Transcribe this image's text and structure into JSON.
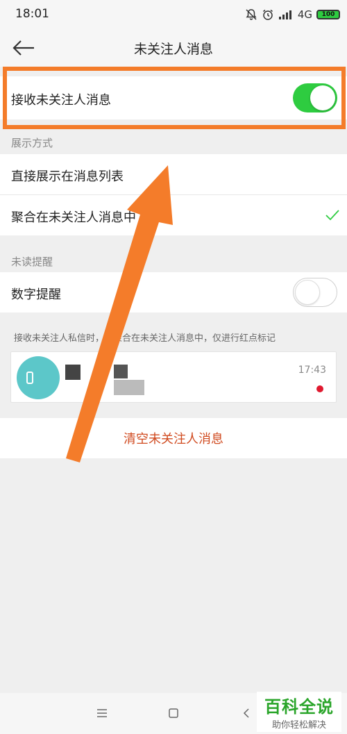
{
  "status_bar": {
    "time": "18:01",
    "network": "4G",
    "battery": "100",
    "icons": [
      "bell-muted-icon",
      "alarm-icon",
      "signal-icon",
      "battery-icon"
    ]
  },
  "header": {
    "title": "未关注人消息",
    "back_icon": "arrow-left-icon"
  },
  "receive_toggle": {
    "label": "接收未关注人消息",
    "on": true
  },
  "display_mode": {
    "section_label": "展示方式",
    "options": [
      {
        "label": "直接展示在消息列表",
        "selected": false
      },
      {
        "label": "聚合在未关注人消息中",
        "selected": true
      }
    ],
    "check_icon": "checkmark-icon"
  },
  "unread_reminder": {
    "section_label": "未读提醒",
    "digit_label": "数字提醒",
    "digit_on": false
  },
  "preview": {
    "note": "接收未关注人私信时，将聚合在未关注人消息中，仅进行红点标记",
    "time": "17:43"
  },
  "clear_button": {
    "label": "清空未关注人消息"
  },
  "nav": {
    "menu_icon": "menu-icon",
    "home_icon": "square-home-icon",
    "back_icon": "chevron-left-icon"
  },
  "watermark": {
    "title": "百科全说",
    "subtitle": "助你轻松解决"
  },
  "colors": {
    "accent_green": "#2ecc40",
    "highlight_orange": "#f47c2a",
    "danger_text": "#d04a1f",
    "unread_dot": "#e0192f",
    "avatar": "#5cc7c9"
  }
}
